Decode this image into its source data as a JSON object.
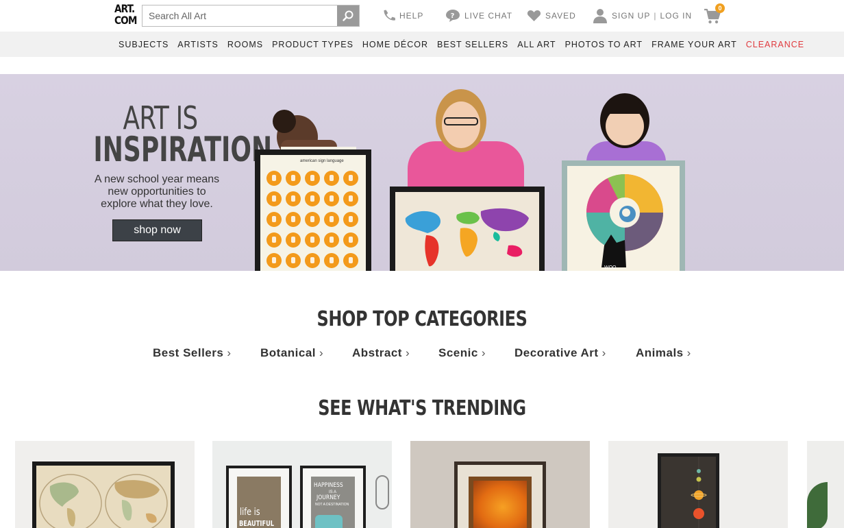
{
  "header": {
    "logo_line1": "ART.",
    "logo_line2": "COM",
    "search_placeholder": "Search All Art",
    "help": "HELP",
    "live_chat": "LIVE CHAT",
    "saved": "SAVED",
    "sign_up": "SIGN UP",
    "separator": "|",
    "log_in": "LOG IN",
    "cart_count": "0"
  },
  "nav": {
    "items": [
      "SUBJECTS",
      "ARTISTS",
      "ROOMS",
      "PRODUCT TYPES",
      "HOME DÉCOR",
      "BEST SELLERS",
      "ALL ART",
      "PHOTOS TO ART",
      "FRAME YOUR ART",
      "CLEARANCE"
    ]
  },
  "hero": {
    "title_line1": "ART IS",
    "title_line2": "INSPIRATION",
    "subtitle_line1": "A new school year means",
    "subtitle_line2": "new opportunities to",
    "subtitle_line3": "explore what they love.",
    "cta": "shop now",
    "poster1_label": "american sign language",
    "poster3_label": "WOO"
  },
  "categories": {
    "title": "SHOP TOP CATEGORIES",
    "items": [
      "Best Sellers",
      "Botanical",
      "Abstract",
      "Scenic",
      "Decorative Art",
      "Animals"
    ]
  },
  "trending": {
    "title": "SEE WHAT'S TRENDING",
    "card2_text1": "life is",
    "card2_text2": "BEAUTIFUL",
    "card2_text3": "HAPPINESS",
    "card2_text4": "IS A",
    "card2_text5": "JOURNEY",
    "card2_text6": "NOT A DESTINATION"
  },
  "colors": {
    "accent_red": "#e03a3e",
    "hero_bg": "#d8d1e2",
    "badge": "#f0a020"
  }
}
